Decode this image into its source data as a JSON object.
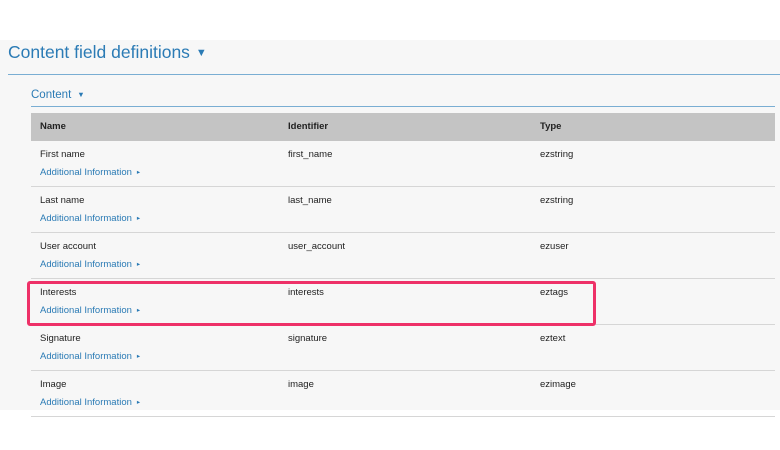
{
  "section": {
    "title": "Content field definitions",
    "caret": "▼"
  },
  "group": {
    "title": "Content",
    "caret": "▼"
  },
  "table": {
    "headers": {
      "name": "Name",
      "identifier": "Identifier",
      "type": "Type"
    },
    "info_caret": "▸",
    "rows": [
      {
        "name": "First name",
        "identifier": "first_name",
        "type": "ezstring",
        "info": "Additional Information"
      },
      {
        "name": "Last name",
        "identifier": "last_name",
        "type": "ezstring",
        "info": "Additional Information"
      },
      {
        "name": "User account",
        "identifier": "user_account",
        "type": "ezuser",
        "info": "Additional Information"
      },
      {
        "name": "Interests",
        "identifier": "interests",
        "type": "eztags",
        "info": "Additional Information"
      },
      {
        "name": "Signature",
        "identifier": "signature",
        "type": "eztext",
        "info": "Additional Information"
      },
      {
        "name": "Image",
        "identifier": "image",
        "type": "ezimage",
        "info": "Additional Information"
      }
    ]
  },
  "colors": {
    "accent": "#2b7bb5",
    "highlight": "#ee3168",
    "header_bg": "#c4c4c4",
    "panel_bg": "#f7f7f7"
  }
}
